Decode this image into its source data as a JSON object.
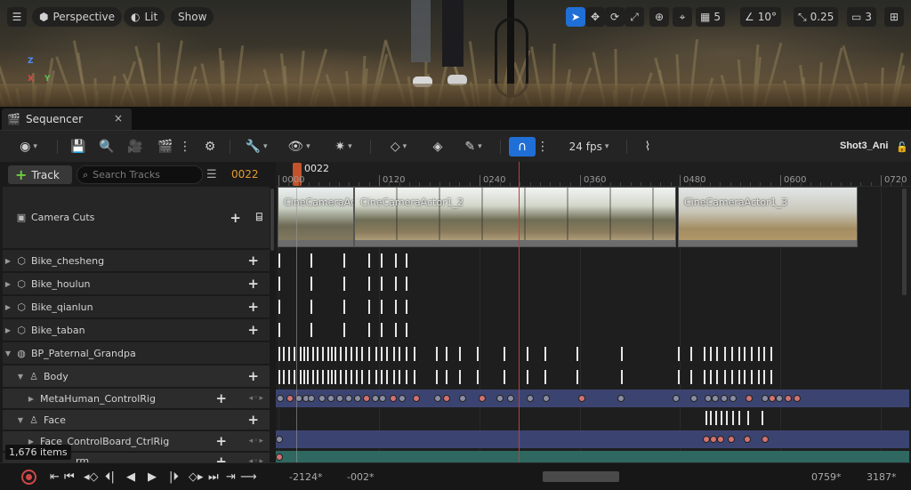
{
  "viewport": {
    "view_mode": "Perspective",
    "lighting": "Lit",
    "show_label": "Show",
    "grid_size": "5",
    "rotation_snap": "10°",
    "scale_snap": "0.25",
    "camera_speed": "3",
    "icons": [
      "menu-icon",
      "perspective-cube-icon",
      "lit-sphere-icon",
      "select-arrow-icon",
      "move-icon",
      "rotate-icon",
      "scale-icon",
      "globe-icon",
      "surface-snap-icon",
      "grid-icon",
      "angle-icon",
      "scale-arrow-icon",
      "camera-icon",
      "maximize-icon"
    ]
  },
  "tab": {
    "label": "Sequencer",
    "close": "×"
  },
  "toolbar": {
    "fps": "24 fps",
    "sequence_name": "Shot3_Ani"
  },
  "tracks_header": {
    "add_track_label": "Track",
    "search_placeholder": "Search Tracks",
    "current_frame": "0022"
  },
  "ruler": {
    "playhead_label": "0022",
    "ticks": [
      "0000",
      "0120",
      "0240",
      "0360",
      "0480",
      "0600",
      "0720"
    ]
  },
  "tree": {
    "rows": [
      {
        "label": "Camera Cuts"
      },
      {
        "label": "Bike_chesheng"
      },
      {
        "label": "Bike_houlun"
      },
      {
        "label": "Bike_qianlun"
      },
      {
        "label": "Bike_taban"
      },
      {
        "label": "BP_Paternal_Grandpa"
      },
      {
        "label": "Body"
      },
      {
        "label": "MetaHuman_ControlRig"
      },
      {
        "label": "Face"
      },
      {
        "label": "Face_ControlBoard_CtrlRig"
      },
      {
        "label": "rm"
      }
    ],
    "items_count": "1,676 items"
  },
  "camera_cuts": [
    {
      "label": "CineCameraActor"
    },
    {
      "label": "CineCameraActor1_2"
    },
    {
      "label": "CineCameraActor1_3"
    }
  ],
  "transport": {
    "range_start": "-2124*",
    "work_start": "-002*",
    "work_end": "0759*",
    "range_end": "3187*"
  },
  "colors": {
    "accent": "#1f6fd6",
    "playhead": "#c2532d",
    "end_marker": "#c43b3b",
    "control_rig_band": "#3b4470",
    "current_frame_text": "#e69b2e"
  }
}
